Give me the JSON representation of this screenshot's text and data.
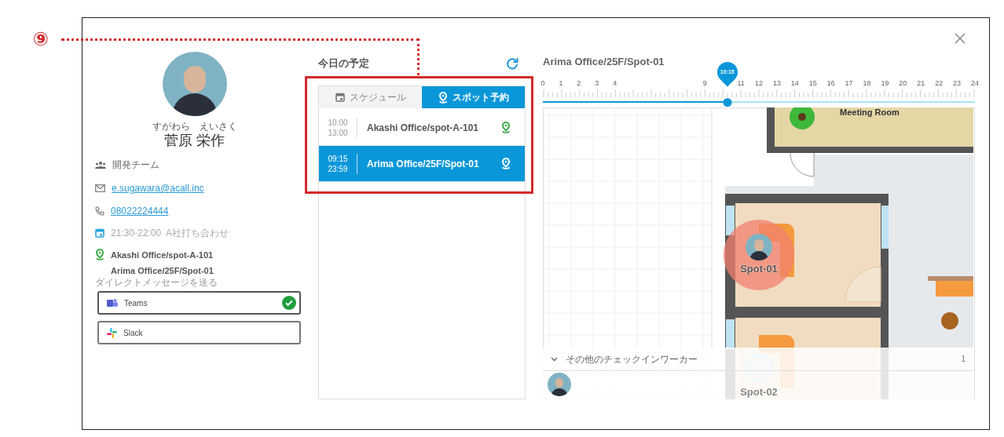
{
  "annotation": {
    "number": "⑨"
  },
  "profile": {
    "furigana": "すがわら　えいさく",
    "name": "菅原 栄作",
    "team": "開発チーム",
    "email": "e.sugawara@acall.inc",
    "phone": "08022224444",
    "event": "21:30-22:00  A社打ち合わせ",
    "locations": [
      "Akashi Office/spot-A-101",
      "Arima Office/25F/Spot-01"
    ],
    "dm_label": "ダイレクトメッセージを送る",
    "dm_buttons": [
      {
        "kind": "teams",
        "label": "Teams",
        "connected": true
      },
      {
        "kind": "slack",
        "label": "Slack",
        "connected": false
      }
    ]
  },
  "schedule": {
    "title": "今日の予定",
    "tabs": [
      {
        "kind": "calendar",
        "label": "スケジュール",
        "selected": false
      },
      {
        "kind": "pin",
        "label": "スポット予約",
        "selected": true
      }
    ],
    "items": [
      {
        "start": "10:00",
        "end": "13:00",
        "place": "Akashi Office/spot-A-101",
        "selected": false
      },
      {
        "start": "09:15",
        "end": "23:59",
        "place": "Arima Office/25F/Spot-01",
        "selected": true
      }
    ]
  },
  "map": {
    "title": "Arima Office/25F/Spot-01",
    "timeline": {
      "ticks": [
        "0",
        "1",
        "2",
        "3",
        "4",
        "9",
        "11",
        "12",
        "13",
        "14",
        "15",
        "16",
        "17",
        "18",
        "19",
        "20",
        "21",
        "22",
        "23",
        "24"
      ],
      "time": "10:15",
      "level": 0.427
    },
    "room_label": "Meeting Room",
    "spots": [
      {
        "label": "Spot-01",
        "occupied": true
      },
      {
        "label": "Spot-02",
        "occupied": false
      }
    ],
    "checkin_panel": {
      "title": "その他のチェックインワーカー",
      "count": "1",
      "expanded": true
    }
  }
}
